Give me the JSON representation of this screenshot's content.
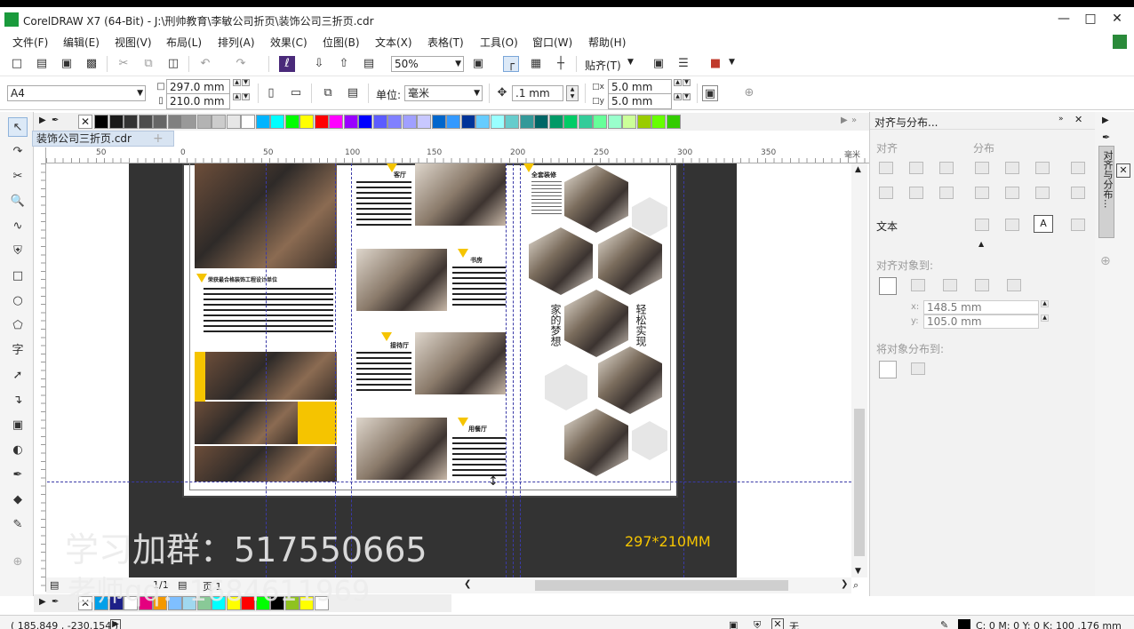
{
  "window": {
    "title": "CorelDRAW X7 (64-Bit) - J:\\刑帅教育\\李敏公司折页\\装饰公司三折页.cdr"
  },
  "menu": [
    "文件(F)",
    "编辑(E)",
    "视图(V)",
    "布局(L)",
    "排列(A)",
    "效果(C)",
    "位图(B)",
    "文本(X)",
    "表格(T)",
    "工具(O)",
    "窗口(W)",
    "帮助(H)"
  ],
  "toolbar": {
    "zoom": "50%",
    "snap_label": "贴齐(T)"
  },
  "property_bar": {
    "page_size": "A4",
    "width": "297.0 mm",
    "height": "210.0 mm",
    "units_label": "单位:",
    "units_value": "毫米",
    "nudge": ".1 mm",
    "dup_x": "5.0 mm",
    "dup_y": "5.0 mm"
  },
  "document_tab": "装饰公司三折页.cdr",
  "ruler": {
    "h_ticks": [
      "50",
      "0",
      "50",
      "100",
      "150",
      "200",
      "250",
      "300",
      "350"
    ],
    "unit": "毫米"
  },
  "canvas": {
    "overlay_text": "学习加群：517550665",
    "overlay_text2": "老师qq：1684611969",
    "size_label": "297*210MM",
    "panel1_heading": "荣获最合格装饰工程设计单位",
    "panel2_labels": [
      "客厅",
      "书房",
      "接待厅",
      "用餐厅"
    ],
    "panel3_heading": "全套装修",
    "panel3_text_left": "家的梦想",
    "panel3_text_right": "轻松实现"
  },
  "page_nav": {
    "current": "1/1",
    "page_tab": "页 1"
  },
  "docker": {
    "title": "对齐与分布...",
    "section_align": "对齐",
    "section_distribute": "分布",
    "text_label": "文本",
    "align_to_label": "对齐对象到:",
    "x_value": "148.5 mm",
    "y_value": "105.0 mm",
    "x_label": "x:",
    "y_label": "y:",
    "distribute_to_label": "将对象分布到:",
    "tab_label": "对齐与分布..."
  },
  "status": {
    "coords": "( 185.849 , -230.154 )",
    "fill": "无",
    "outline": "C: 0 M: 0 Y: 0 K: 100  .176 mm"
  },
  "palette_colors": [
    "#000000",
    "#1a1a1a",
    "#333333",
    "#4d4d4d",
    "#666666",
    "#808080",
    "#999999",
    "#b3b3b3",
    "#cccccc",
    "#e6e6e6",
    "#ffffff",
    "#00b4ff",
    "#00ffff",
    "#00ff00",
    "#ffff00",
    "#ff0000",
    "#ff00ff",
    "#9900ff",
    "#0000ff",
    "#5c5cff",
    "#8080ff",
    "#a0a0ff",
    "#c8c8ff",
    "#0066cc",
    "#3399ff",
    "#003399",
    "#66ccff",
    "#99ffff",
    "#66cccc",
    "#339999",
    "#006666",
    "#009966",
    "#00cc66",
    "#33cc99",
    "#66ff99",
    "#99ffcc",
    "#ccff99",
    "#99cc00",
    "#66ff00",
    "#33cc00"
  ],
  "palette_bottom": [
    "#00a0e9",
    "#1d2088",
    "#ffffff",
    "#e4007f",
    "#f39800",
    "#7fbfff",
    "#a0d8ef",
    "#89c997",
    "#00ffff",
    "#ffff00",
    "#ff0000",
    "#00ff00",
    "#000000",
    "#8fc31f",
    "#ffff00",
    "#ffffff"
  ]
}
